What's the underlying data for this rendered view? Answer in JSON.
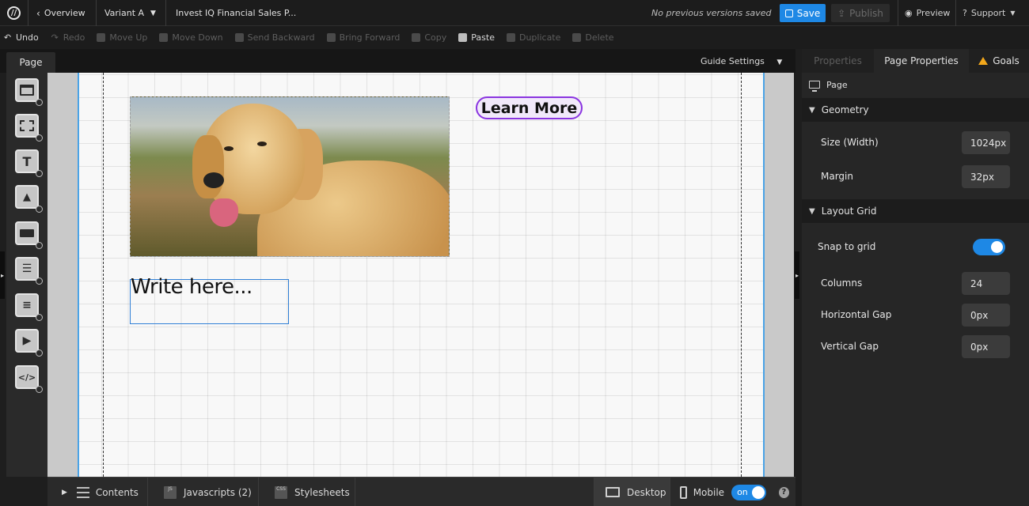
{
  "topbar": {
    "back_label": "Overview",
    "variant_label": "Variant A",
    "page_title": "Invest IQ Financial Sales P...",
    "version_status": "No previous versions saved",
    "save_label": "Save",
    "publish_label": "Publish",
    "preview_label": "Preview",
    "support_label": "Support"
  },
  "toolbar": {
    "undo": "Undo",
    "redo": "Redo",
    "move_up": "Move Up",
    "move_down": "Move Down",
    "send_backward": "Send Backward",
    "bring_forward": "Bring Forward",
    "copy": "Copy",
    "paste": "Paste",
    "duplicate": "Duplicate",
    "delete": "Delete"
  },
  "page_header": {
    "tab_label": "Page",
    "guide_settings": "Guide Settings"
  },
  "left_tools": [
    "section-tool",
    "box-tool",
    "text-tool",
    "image-tool",
    "button-tool",
    "form-tool",
    "list-tool",
    "video-tool",
    "code-tool"
  ],
  "left_tools_glyphs": {
    "text": "T"
  },
  "canvas": {
    "button_label": "Learn More",
    "text_placeholder": "Write here...",
    "accent_color": "#8a35e0"
  },
  "bottombar": {
    "contents": "Contents",
    "javascripts": "Javascripts (2)",
    "stylesheets": "Stylesheets",
    "desktop": "Desktop",
    "mobile": "Mobile",
    "toggle": "on",
    "help": "?",
    "file_js": "JS",
    "file_css": "CSS"
  },
  "right_panel": {
    "tabs": [
      "Properties",
      "Page Properties",
      "Goals"
    ],
    "page_label": "Page",
    "geometry": {
      "title": "Geometry",
      "size_label": "Size (Width)",
      "size_value": "1024px",
      "margin_label": "Margin",
      "margin_value": "32px"
    },
    "layout_grid": {
      "title": "Layout Grid",
      "snap_label": "Snap to grid",
      "snap_enabled": true,
      "columns_label": "Columns",
      "columns_value": "24",
      "hgap_label": "Horizontal Gap",
      "hgap_value": "0px",
      "vgap_label": "Vertical Gap",
      "vgap_value": "0px"
    }
  },
  "colors": {
    "save_blue": "#1e88e5",
    "selection_blue": "#2f7fd6",
    "warning": "#f2a71b"
  }
}
